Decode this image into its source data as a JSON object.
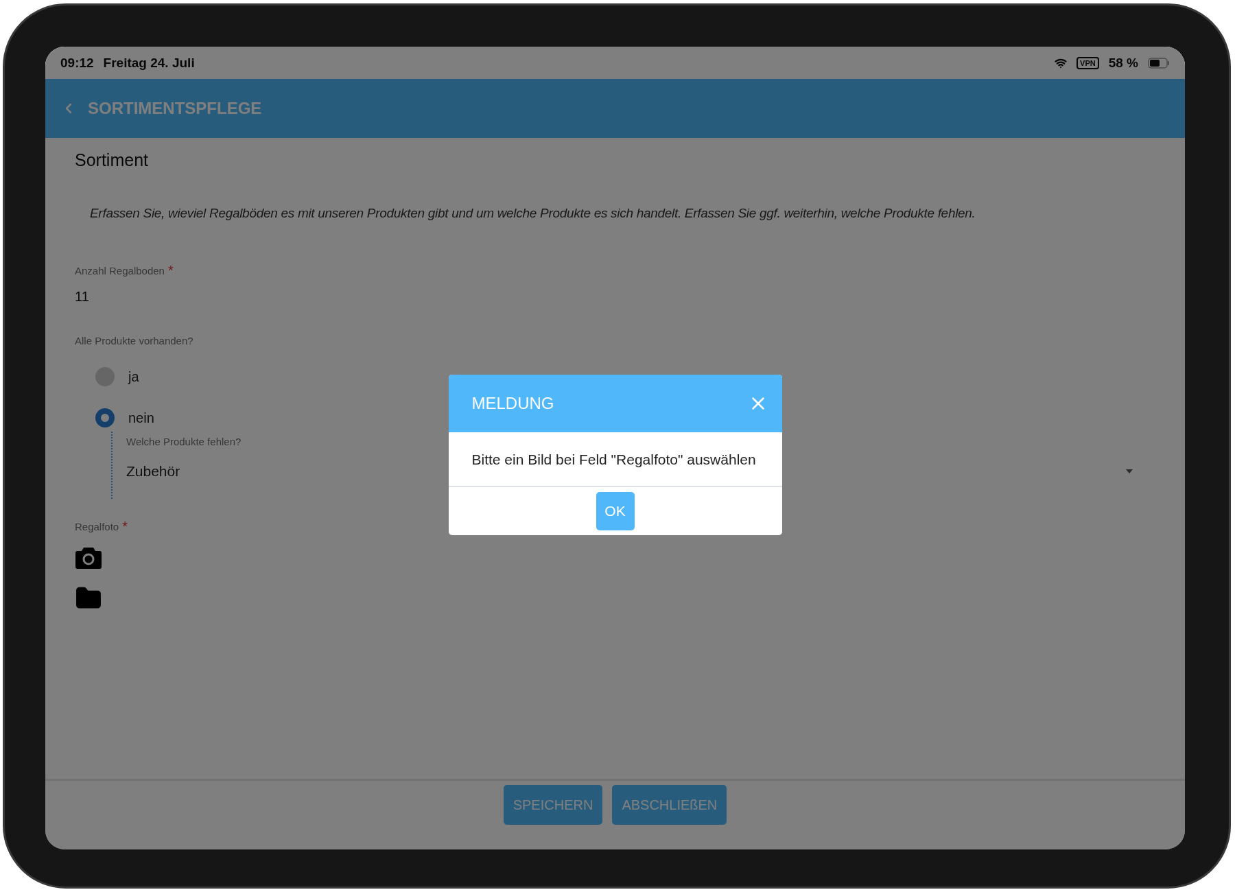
{
  "status_bar": {
    "time": "09:12",
    "date": "Freitag 24. Juli",
    "vpn": "VPN",
    "battery": "58 %"
  },
  "app_bar": {
    "title": "SORTIMENTSPFLEGE"
  },
  "section_title": "Sortiment",
  "description": "Erfassen Sie, wieviel Regalböden es mit unseren Produkten gibt und um welche Produkte es sich handelt. Erfassen Sie ggf. weiterhin, welche Produkte fehlen.",
  "fields": [
    {
      "kind": "text",
      "label": "Anzahl Regalboden",
      "mark": "*",
      "value": "11"
    },
    {
      "kind": "radio",
      "label": "Alle Produkte vorhanden?",
      "options": [
        {
          "label": "ja",
          "selected": false
        },
        {
          "label": "nein",
          "selected": true
        }
      ],
      "sub_field": {
        "label": "Welche Produkte fehlen?",
        "value": "Zubehör"
      }
    },
    {
      "kind": "photo",
      "label": "Regalfoto",
      "mark": "*"
    }
  ],
  "footer_buttons": [
    "SPEICHERN",
    "ABSCHLIEßEN"
  ],
  "dialog": {
    "title": "MELDUNG",
    "message": "Bitte ein Bild bei Feld \"Regalfoto\" auswählen",
    "button": "OK"
  }
}
